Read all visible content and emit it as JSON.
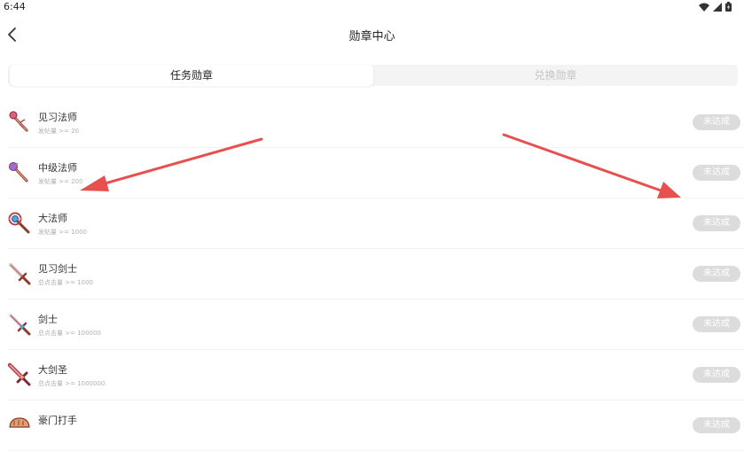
{
  "status": {
    "time": "6:44"
  },
  "header": {
    "title": "勋章中心"
  },
  "tabs": [
    {
      "label": "任务勋章",
      "active": true
    },
    {
      "label": "兑换勋章",
      "active": false
    }
  ],
  "badges": [
    {
      "name": "见习法师",
      "condition": "发帖量 >= 20",
      "status": "未达成",
      "icon": "wand-icon",
      "gem": "#e0607a"
    },
    {
      "name": "中级法师",
      "condition": "发帖量 >= 200",
      "status": "未达成",
      "icon": "wand-icon",
      "gem": "#9b6fd3"
    },
    {
      "name": "大法师",
      "condition": "发帖量 >= 1000",
      "status": "未达成",
      "icon": "staff-icon",
      "gem": "#e0607a"
    },
    {
      "name": "见习剑士",
      "condition": "总点击量 >= 1000",
      "status": "未达成",
      "icon": "sword-icon",
      "gem": "#e07070"
    },
    {
      "name": "剑士",
      "condition": "总点击量 >= 100000",
      "status": "未达成",
      "icon": "sword-icon",
      "gem": "#4fa3e0"
    },
    {
      "name": "大剑圣",
      "condition": "总点击量 >= 1000000",
      "status": "未达成",
      "icon": "sword-icon",
      "gem": "#c0304a"
    },
    {
      "name": "豪门打手",
      "condition": "",
      "status": "未达成",
      "icon": "fist-icon",
      "gem": "#e0a070"
    }
  ],
  "colors": {
    "accent": "#e8504f",
    "button_bg": "#dcdcdc",
    "tab_inactive": "#c4c4c4"
  }
}
